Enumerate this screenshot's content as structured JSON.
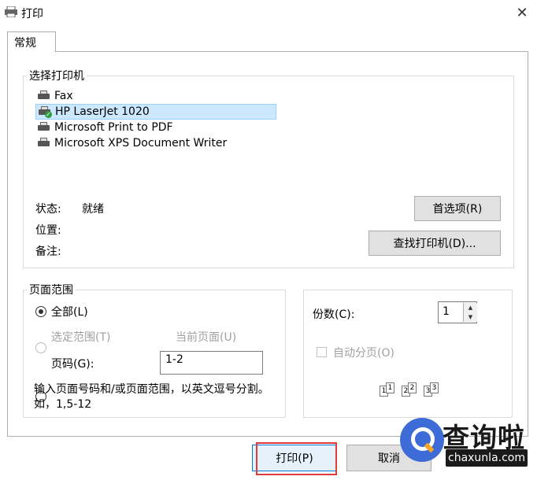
{
  "window": {
    "title": "打印",
    "close_label": "✕"
  },
  "tabs": [
    {
      "label": "常规"
    }
  ],
  "printer_group": {
    "label": "选择打印机",
    "printers": [
      {
        "name": "Fax",
        "selected": false,
        "default": false
      },
      {
        "name": "HP LaserJet 1020",
        "selected": true,
        "default": true
      },
      {
        "name": "Microsoft Print to PDF",
        "selected": false,
        "default": false
      },
      {
        "name": "Microsoft XPS Document Writer",
        "selected": false,
        "default": false
      }
    ],
    "status_label": "状态:",
    "status_value": "就绪",
    "location_label": "位置:",
    "comment_label": "备注:",
    "preferences_button": "首选项(R)",
    "find_printer_button": "查找打印机(D)..."
  },
  "page_range": {
    "label": "页面范围",
    "all": "全部(L)",
    "selection": "选定范围(T)",
    "current_page": "当前页面(U)",
    "pages": "页码(G):",
    "pages_value": "1-2",
    "hint": "输入页面号码和/或页面范围，以英文逗号分割。如，1,5-12"
  },
  "copies": {
    "label": "份数(C):",
    "value": "1",
    "collate": "自动分页(O)",
    "collate_icons": [
      "1",
      "1",
      "2",
      "2",
      "3",
      "3"
    ]
  },
  "buttons": {
    "print": "打印(P)",
    "cancel": "取消"
  },
  "watermark": {
    "text": "查询啦",
    "sub": "chaxunla.com"
  },
  "colors": {
    "selection_bg": "#cce8ff",
    "default_button_border": "#0078d7",
    "highlight": "#e03c3c"
  }
}
